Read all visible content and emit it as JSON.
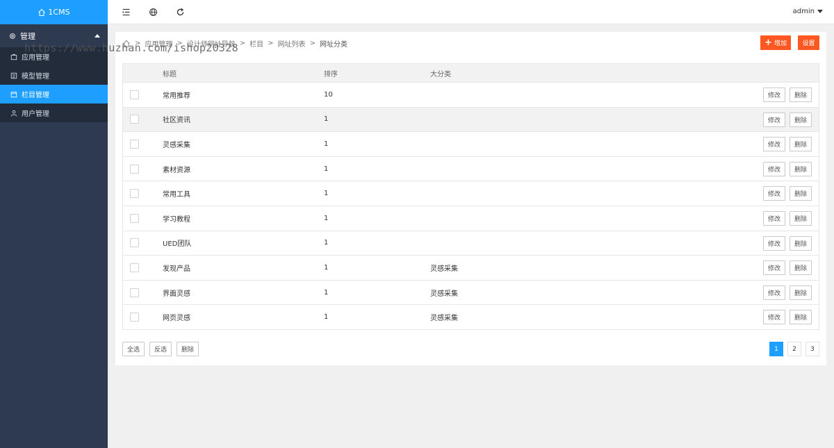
{
  "app": {
    "logo_text": "1CMS",
    "user": "admin"
  },
  "sidebar": {
    "group_label": "管理",
    "items": [
      {
        "label": "应用管理",
        "icon": "app-icon"
      },
      {
        "label": "模型管理",
        "icon": "model-icon"
      },
      {
        "label": "栏目管理",
        "icon": "calendar-icon",
        "active": true
      },
      {
        "label": "用户管理",
        "icon": "user-icon"
      }
    ]
  },
  "breadcrumb": [
    "应用管理",
    "设计师网址导航",
    "栏目",
    "网址列表",
    "网址分类"
  ],
  "toolbar": {
    "add_label": "增加",
    "settings_label": "设置"
  },
  "watermark": "https://www.huzhan.com/ishop20328",
  "table": {
    "headers": {
      "title": "标题",
      "order": "排序",
      "category": "大分类"
    },
    "rows": [
      {
        "title": "常用推荐",
        "order": "10",
        "category": ""
      },
      {
        "title": "社区资讯",
        "order": "1",
        "category": ""
      },
      {
        "title": "灵感采集",
        "order": "1",
        "category": ""
      },
      {
        "title": "素材资源",
        "order": "1",
        "category": ""
      },
      {
        "title": "常用工具",
        "order": "1",
        "category": ""
      },
      {
        "title": "学习教程",
        "order": "1",
        "category": ""
      },
      {
        "title": "UED团队",
        "order": "1",
        "category": ""
      },
      {
        "title": "发现产品",
        "order": "1",
        "category": "灵感采集"
      },
      {
        "title": "界面灵感",
        "order": "1",
        "category": "灵感采集"
      },
      {
        "title": "网页灵感",
        "order": "1",
        "category": "灵感采集"
      }
    ],
    "edit_label": "修改",
    "delete_label": "删除"
  },
  "footer": {
    "select_all": "全选",
    "invert": "反选",
    "delete": "删除"
  },
  "pagination": {
    "pages": [
      "1",
      "2",
      "3"
    ],
    "current": "1"
  },
  "colors": {
    "accent": "#1e9fff",
    "sidebar": "#2d3a4f",
    "orange": "#ff5722"
  }
}
